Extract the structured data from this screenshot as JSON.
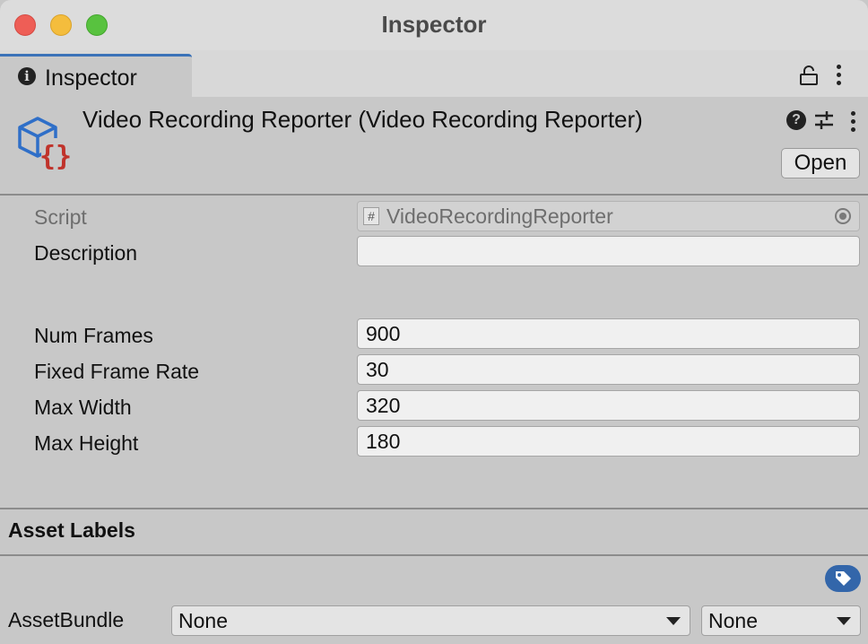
{
  "window": {
    "title": "Inspector"
  },
  "tab": {
    "label": "Inspector"
  },
  "header": {
    "title": "Video Recording Reporter (Video Recording Reporter)",
    "open_label": "Open"
  },
  "properties": {
    "script": {
      "label": "Script",
      "value": "VideoRecordingReporter"
    },
    "description": {
      "label": "Description",
      "value": ""
    },
    "num_frames": {
      "label": "Num Frames",
      "value": "900"
    },
    "fixed_frame_rate": {
      "label": "Fixed Frame Rate",
      "value": "30"
    },
    "max_width": {
      "label": "Max Width",
      "value": "320"
    },
    "max_height": {
      "label": "Max Height",
      "value": "180"
    }
  },
  "asset_labels": {
    "heading": "Asset Labels",
    "bundle_label": "AssetBundle",
    "bundle_value": "None",
    "variant_value": "None"
  },
  "icons": {
    "tab": "info-icon",
    "lock": "lock-icon",
    "menu": "kebab-menu-icon",
    "script": "script-icon",
    "help": "help-icon",
    "presets": "presets-icon",
    "script_field": "hash-icon",
    "object_picker": "target-icon",
    "labels": "tag-icon",
    "dropdown": "chevron-down-icon"
  },
  "colors": {
    "accent": "#3a72b8",
    "tag_button": "#3366aa",
    "script_icon_blue": "#2f6fc8",
    "script_icon_red": "#c0332b"
  }
}
